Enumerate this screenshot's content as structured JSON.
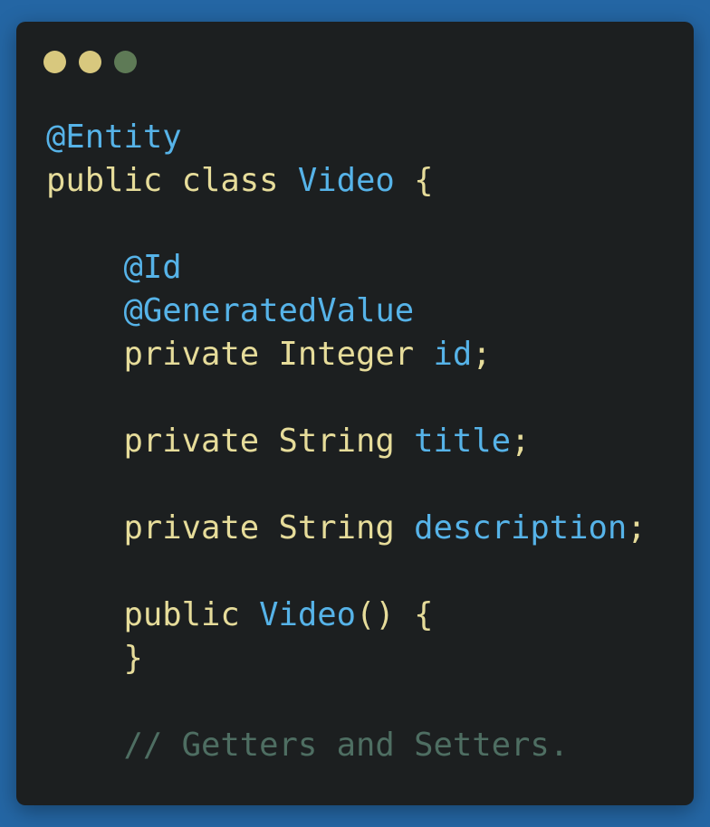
{
  "window": {
    "controls": [
      {
        "name": "close",
        "color": "#d8c87e"
      },
      {
        "name": "minimize",
        "color": "#d8c87e"
      },
      {
        "name": "maximize",
        "color": "#5e7a56"
      }
    ]
  },
  "code": {
    "language": "java",
    "lines": [
      "@Entity",
      "public class Video {",
      "",
      "    @Id",
      "    @GeneratedValue",
      "    private Integer id;",
      "",
      "    private String title;",
      "",
      "    private String description;",
      "",
      "    public Video() {",
      "    }",
      "",
      "    // Getters and Setters."
    ],
    "tokens": {
      "ann_entity": "@Entity",
      "kw_public": "public",
      "kw_class": "class",
      "cls_video": "Video",
      "brace_open": "{",
      "ann_id": "@Id",
      "ann_generated": "@GeneratedValue",
      "kw_private": "private",
      "type_integer": "Integer",
      "ident_id": "id",
      "semicolon": ";",
      "type_string": "String",
      "ident_title": "title",
      "ident_description": "description",
      "ctor_name": "Video",
      "parens": "()",
      "brace_close": "}",
      "comment": "// Getters and Setters."
    }
  },
  "colors": {
    "background": "#2466a4",
    "editor": "#1c1f20",
    "annotation": "#56b3e8",
    "keyword": "#e6dc9a",
    "identifier": "#56b3e8",
    "comment": "#4e6e62"
  }
}
